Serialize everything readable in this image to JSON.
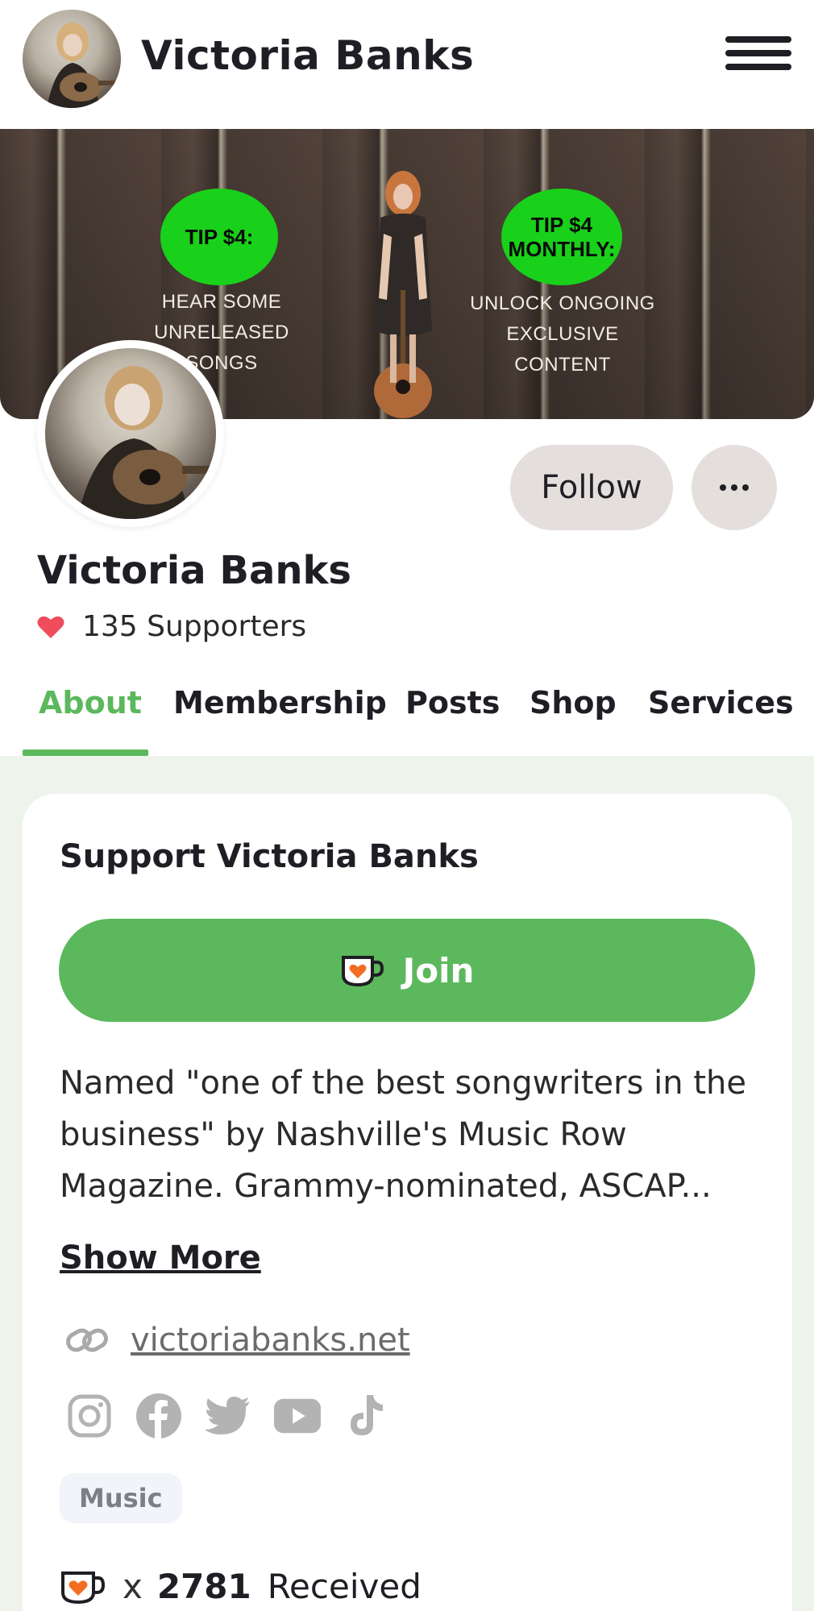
{
  "header": {
    "title": "Victoria Banks"
  },
  "cover": {
    "tip_one_circle": "TIP $4:",
    "tip_one_caption_line1": "HEAR SOME",
    "tip_one_caption_line2": "UNRELEASED SONGS",
    "tip_two_circle_line1": "TIP $4",
    "tip_two_circle_line2": "MONTHLY:",
    "tip_two_caption_line1": "UNLOCK ONGOING",
    "tip_two_caption_line2": "EXCLUSIVE CONTENT"
  },
  "profile": {
    "name": "Victoria Banks",
    "supporters": "135 Supporters",
    "follow_label": "Follow"
  },
  "tabs": [
    {
      "label": "About"
    },
    {
      "label": "Membership"
    },
    {
      "label": "Posts"
    },
    {
      "label": "Shop"
    },
    {
      "label": "Services"
    }
  ],
  "support": {
    "title": "Support Victoria Banks",
    "join_label": "Join",
    "bio": "Named \"one of the best songwriters in the business\" by Nashville's Music Row Magazine. Grammy-nominated, ASCAP...",
    "show_more": "Show More",
    "website": "victoriabanks.net",
    "tag": "Music",
    "received_x": "x",
    "received_count": "2781",
    "received_label": "Received"
  },
  "colors": {
    "accent": "#5cb85c",
    "tip_circle": "#19d11a",
    "heart": "#ef4c5c",
    "body_bg": "#eef3ec"
  },
  "icons": {
    "menu": "hamburger-icon",
    "more": "more-horizontal-icon",
    "heart": "heart-icon",
    "cup": "coffee-cup-heart-icon",
    "link": "link-icon",
    "socials": [
      "instagram-icon",
      "facebook-icon",
      "twitter-icon",
      "youtube-icon",
      "tiktok-icon"
    ]
  }
}
